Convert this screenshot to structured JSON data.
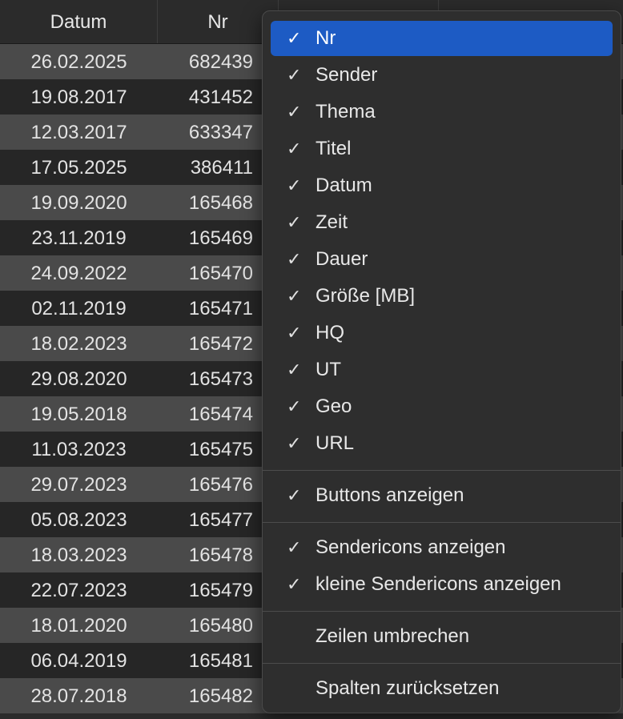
{
  "table": {
    "columns": [
      "Datum",
      "Nr",
      "",
      ""
    ],
    "rows": [
      {
        "datum": "26.02.2025",
        "nr": "682439"
      },
      {
        "datum": "19.08.2017",
        "nr": "431452"
      },
      {
        "datum": "12.03.2017",
        "nr": "633347"
      },
      {
        "datum": "17.05.2025",
        "nr": "386411"
      },
      {
        "datum": "19.09.2020",
        "nr": "165468"
      },
      {
        "datum": "23.11.2019",
        "nr": "165469"
      },
      {
        "datum": "24.09.2022",
        "nr": "165470"
      },
      {
        "datum": "02.11.2019",
        "nr": "165471"
      },
      {
        "datum": "18.02.2023",
        "nr": "165472"
      },
      {
        "datum": "29.08.2020",
        "nr": "165473"
      },
      {
        "datum": "19.05.2018",
        "nr": "165474"
      },
      {
        "datum": "11.03.2023",
        "nr": "165475"
      },
      {
        "datum": "29.07.2023",
        "nr": "165476"
      },
      {
        "datum": "05.08.2023",
        "nr": "165477"
      },
      {
        "datum": "18.03.2023",
        "nr": "165478"
      },
      {
        "datum": "22.07.2023",
        "nr": "165479"
      },
      {
        "datum": "18.01.2020",
        "nr": "165480"
      },
      {
        "datum": "06.04.2019",
        "nr": "165481"
      },
      {
        "datum": "28.07.2018",
        "nr": "165482"
      }
    ]
  },
  "menu": {
    "check_glyph": "✓",
    "groups": [
      {
        "items": [
          {
            "label": "Nr",
            "checked": true,
            "selected": true
          },
          {
            "label": "Sender",
            "checked": true
          },
          {
            "label": "Thema",
            "checked": true
          },
          {
            "label": "Titel",
            "checked": true
          },
          {
            "label": "Datum",
            "checked": true
          },
          {
            "label": "Zeit",
            "checked": true
          },
          {
            "label": "Dauer",
            "checked": true
          },
          {
            "label": "Größe [MB]",
            "checked": true
          },
          {
            "label": "HQ",
            "checked": true
          },
          {
            "label": "UT",
            "checked": true
          },
          {
            "label": "Geo",
            "checked": true
          },
          {
            "label": "URL",
            "checked": true
          }
        ]
      },
      {
        "items": [
          {
            "label": "Buttons anzeigen",
            "checked": true
          }
        ]
      },
      {
        "items": [
          {
            "label": "Sendericons anzeigen",
            "checked": true
          },
          {
            "label": "kleine Sendericons anzeigen",
            "checked": true
          }
        ]
      },
      {
        "items": [
          {
            "label": "Zeilen umbrechen",
            "checked": false
          }
        ]
      },
      {
        "items": [
          {
            "label": "Spalten zurücksetzen",
            "checked": false
          }
        ]
      }
    ]
  },
  "colors": {
    "selection": "#1d5bc4",
    "menu_bg": "#2e2e2e",
    "row_light": "#4a4a4a",
    "row_dark": "#262626"
  }
}
